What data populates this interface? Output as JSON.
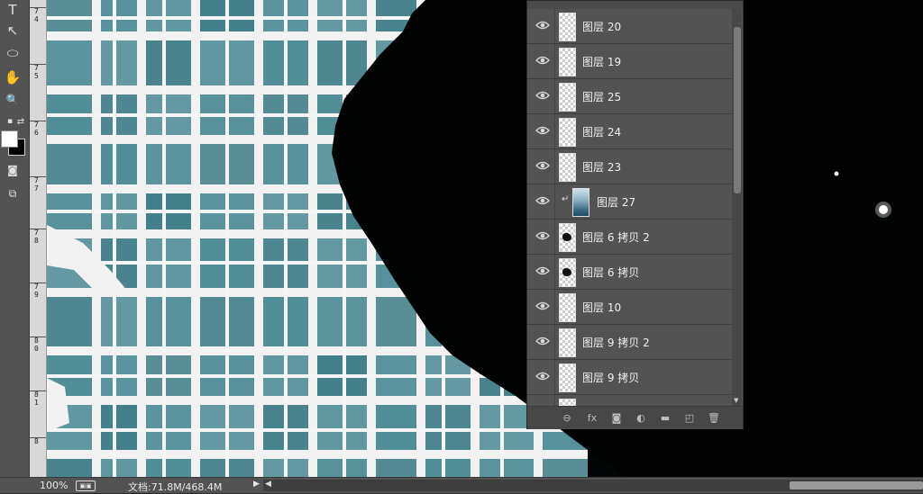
{
  "toolbar": {
    "tools": [
      {
        "icon": "type-tool-icon",
        "glyph": "T"
      },
      {
        "icon": "path-selection-icon",
        "glyph": "↖"
      },
      {
        "icon": "ellipse-tool-icon",
        "glyph": "⬭"
      },
      {
        "icon": "hand-tool-icon",
        "glyph": "✋"
      },
      {
        "icon": "zoom-tool-icon",
        "glyph": "🔍"
      }
    ]
  },
  "ruler": {
    "labels": [
      "7\n4",
      "7\n5",
      "7\n6",
      "7\n7",
      "7\n8",
      "7\n9",
      "8\n0",
      "8\n1",
      "8"
    ]
  },
  "layers": [
    {
      "name": "图层 20",
      "thumb": "transparent",
      "visible": true
    },
    {
      "name": "图层 19",
      "thumb": "transparent",
      "visible": true
    },
    {
      "name": "图层 25",
      "thumb": "transparent",
      "visible": true
    },
    {
      "name": "图层 24",
      "thumb": "transparent",
      "visible": true
    },
    {
      "name": "图层 23",
      "thumb": "transparent",
      "visible": true
    },
    {
      "name": "图层 27",
      "thumb": "image",
      "visible": true,
      "clipped": true
    },
    {
      "name": "图层 6 拷贝 2",
      "thumb": "blob",
      "visible": true
    },
    {
      "name": "图层 6 拷贝",
      "thumb": "blob",
      "visible": true
    },
    {
      "name": "图层 10",
      "thumb": "transparent",
      "visible": true
    },
    {
      "name": "图层 9 拷贝 2",
      "thumb": "transparent",
      "visible": true
    },
    {
      "name": "图层 9 拷贝",
      "thumb": "transparent",
      "visible": true
    },
    {
      "name": "",
      "thumb": "transparent",
      "visible": true
    }
  ],
  "panel_bottom_icons": [
    {
      "name": "link-layers-icon",
      "glyph": "⊖"
    },
    {
      "name": "fx-icon",
      "glyph": "fx"
    },
    {
      "name": "add-mask-icon",
      "glyph": "◙"
    },
    {
      "name": "adjustment-layer-icon",
      "glyph": "◐"
    },
    {
      "name": "new-group-icon",
      "glyph": "▬"
    },
    {
      "name": "new-layer-icon",
      "glyph": "◰"
    },
    {
      "name": "delete-layer-icon",
      "glyph": "🗑"
    }
  ],
  "status": {
    "zoom": "100%",
    "doc_info": "文档:71.8M/468.4M"
  },
  "colors": {
    "teal": "#4c8a93",
    "teal_dark": "#3e7c85",
    "panel": "#535353"
  }
}
